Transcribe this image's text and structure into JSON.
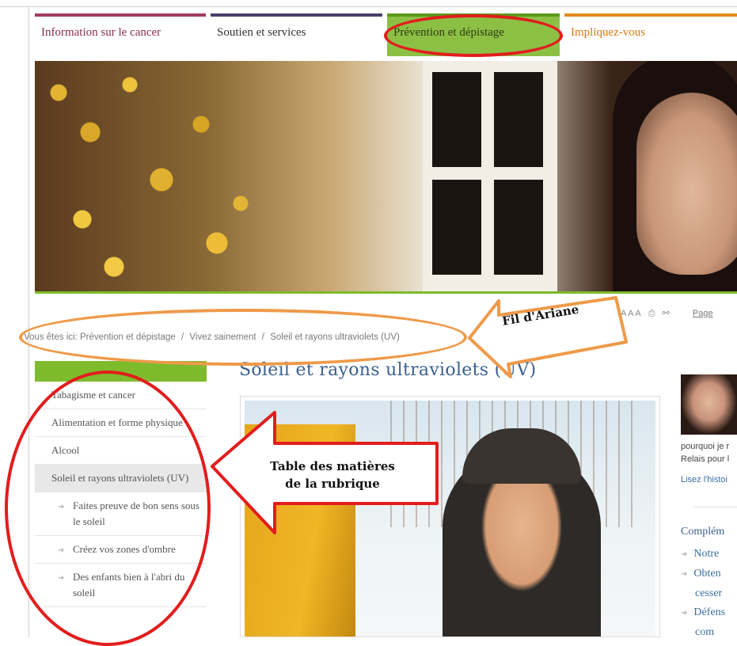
{
  "nav": {
    "tabs": [
      {
        "label": "Information sur le cancer"
      },
      {
        "label": "Soutien et services"
      },
      {
        "label": "Prévention et dépistage"
      },
      {
        "label": "Impliquez-vous"
      }
    ]
  },
  "tools": {
    "text_size": "A A A",
    "print_icon": "printer-icon",
    "share_icon": "link-icon",
    "page_label": "Page"
  },
  "breadcrumb": {
    "prefix": "Vous êtes ici:",
    "items": [
      "Prévention et dépistage",
      "Vivez sainement",
      "Soleil et rayons ultraviolets (UV)"
    ],
    "separator": "/"
  },
  "sidebar": {
    "items": [
      {
        "label": "Tabagisme et cancer"
      },
      {
        "label": "Alimentation et forme physique"
      },
      {
        "label": "Alcool"
      },
      {
        "label": "Soleil et rayons ultraviolets (UV)"
      }
    ],
    "subitems": [
      {
        "label": "Faites preuve de bon sens sous le soleil"
      },
      {
        "label": "Créez vos zones d'ombre"
      },
      {
        "label": "Des enfants bien à l'abri du soleil"
      }
    ]
  },
  "main": {
    "title": "Soleil et rayons ultraviolets (UV)"
  },
  "right": {
    "text_line1": "pourquoi je r",
    "text_line2": "Relais pour l",
    "link": "Lisez l'histoi",
    "heading": "Complém",
    "list": [
      "Notre",
      "Obten",
      "cesser",
      "Défens",
      "com"
    ]
  },
  "annotations": {
    "breadcrumb_label": "Fil d'Ariane",
    "toc_label_line1": "Table des matières",
    "toc_label_line2": "de la rubrique"
  },
  "colors": {
    "accent_green": "#7dbb2c",
    "annotation_red": "#e21d1d",
    "annotation_orange": "#ef9a4a",
    "link_blue": "#3a6ea5"
  }
}
